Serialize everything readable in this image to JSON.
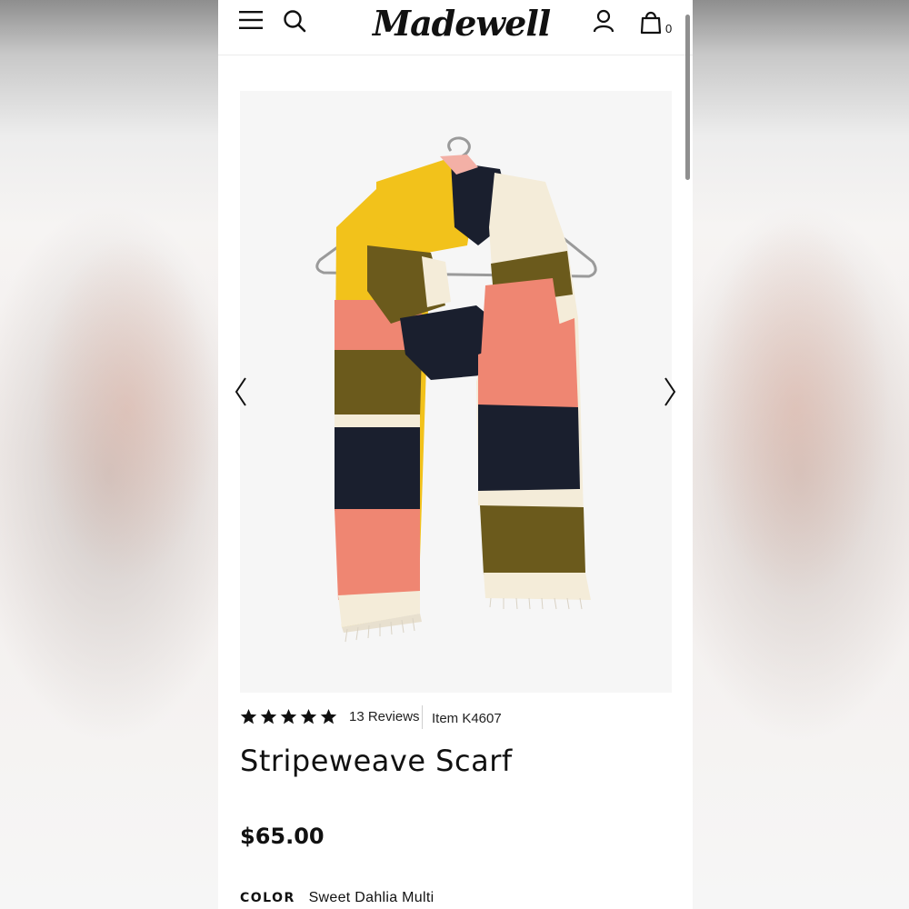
{
  "brand": {
    "logo_text": "Madewell"
  },
  "header": {
    "icons": [
      "menu-icon",
      "search-icon",
      "account-icon",
      "bag-icon"
    ],
    "bag_count": "0"
  },
  "gallery": {
    "image_subject": "striped scarf on hanger",
    "colors": {
      "yellow": "#f2c21b",
      "olive": "#6b5a1c",
      "navy": "#1a1f2e",
      "coral": "#ef8672",
      "cream": "#f4ecd9",
      "blush": "#f3b0a6"
    }
  },
  "product": {
    "rating": 5,
    "reviews_text": "13 Reviews",
    "item_text": "Item K4607",
    "title": "Stripeweave Scarf",
    "price": "$65.00",
    "color_label": "COLOR",
    "color_value": "Sweet Dahlia Multi"
  }
}
